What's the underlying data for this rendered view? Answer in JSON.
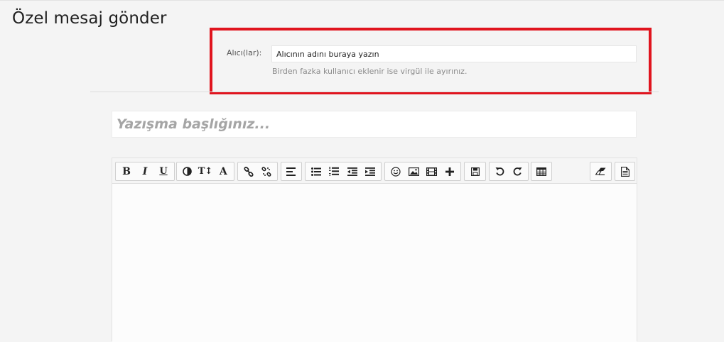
{
  "page": {
    "title": "Özel mesaj gönder"
  },
  "recipients": {
    "label": "Alıcı(lar):",
    "value": "Alıcının adını buraya yazın",
    "hint": "Birden fazka kullanıcı eklenir ise virgül ile ayırınız."
  },
  "subject": {
    "placeholder": "Yazışma başlığınız..."
  },
  "highlight_color": "#e0141e",
  "toolbar": {
    "bold": "B",
    "italic": "I",
    "underline": "U",
    "font_size": "T↕",
    "font": "A",
    "icons": [
      "bold-icon",
      "italic-icon",
      "underline-icon",
      "color-icon",
      "font-size-icon",
      "font-icon",
      "link-icon",
      "unlink-icon",
      "align-left-icon",
      "bullet-list-icon",
      "numbered-list-icon",
      "outdent-icon",
      "indent-icon",
      "emoji-icon",
      "image-icon",
      "video-icon",
      "plus-icon",
      "save-icon",
      "undo-icon",
      "redo-icon",
      "table-icon",
      "eraser-icon",
      "source-icon"
    ]
  }
}
